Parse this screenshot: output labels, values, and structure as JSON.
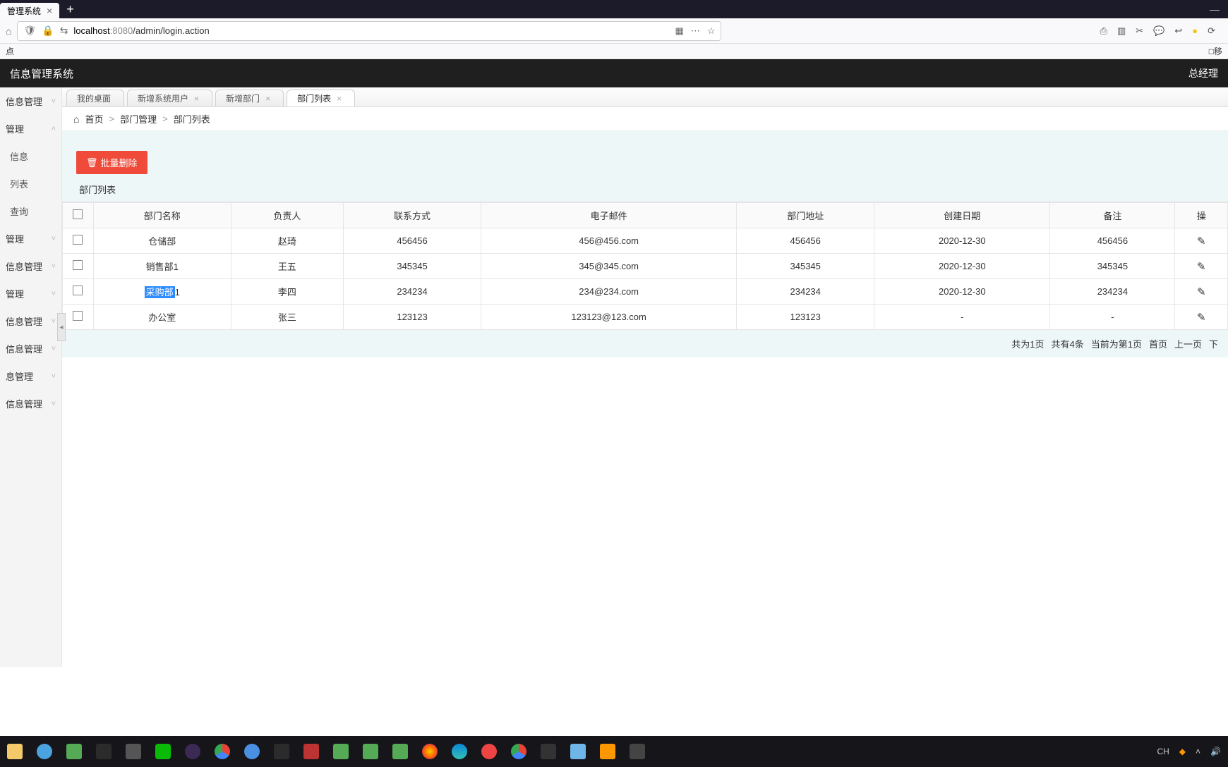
{
  "browser": {
    "tab_title": "管理系统",
    "url_host": "localhost",
    "url_port": ":8080",
    "url_path": "/admin/login.action",
    "bookmark": "点",
    "bookmark_right": "□移"
  },
  "header": {
    "title": "信息管理系统",
    "user": "总经理"
  },
  "sidebar": {
    "items": [
      {
        "label": "信息管理"
      },
      {
        "label": "管理"
      },
      {
        "label": "信息"
      },
      {
        "label": "列表"
      },
      {
        "label": "查询"
      },
      {
        "label": "管理"
      },
      {
        "label": "信息管理"
      },
      {
        "label": "管理"
      },
      {
        "label": "信息管理"
      },
      {
        "label": "信息管理"
      },
      {
        "label": "息管理"
      },
      {
        "label": "信息管理"
      }
    ]
  },
  "tabs": [
    {
      "label": "我的桌面",
      "closable": false
    },
    {
      "label": "新增系统用户",
      "closable": true
    },
    {
      "label": "新增部门",
      "closable": true
    },
    {
      "label": "部门列表",
      "closable": true
    }
  ],
  "breadcrumb": {
    "home": "首页",
    "mid": "部门管理",
    "last": "部门列表"
  },
  "toolbar": {
    "batch_delete": "批量删除"
  },
  "panel_title": "部门列表",
  "table": {
    "headers": [
      "部门名称",
      "负责人",
      "联系方式",
      "电子邮件",
      "部门地址",
      "创建日期",
      "备注",
      "操"
    ],
    "rows": [
      {
        "name": "仓储部",
        "leader": "赵琦",
        "phone": "456456",
        "email": "456@456.com",
        "addr": "456456",
        "date": "2020-12-30",
        "note": "456456"
      },
      {
        "name": "销售部1",
        "leader": "王五",
        "phone": "345345",
        "email": "345@345.com",
        "addr": "345345",
        "date": "2020-12-30",
        "note": "345345"
      },
      {
        "name": "采购部1",
        "leader": "李四",
        "phone": "234234",
        "email": "234@234.com",
        "addr": "234234",
        "date": "2020-12-30",
        "note": "234234",
        "selected": true
      },
      {
        "name": "办公室",
        "leader": "张三",
        "phone": "123123",
        "email": "123123@123.com",
        "addr": "123123",
        "date": "-",
        "note": "-"
      }
    ]
  },
  "pager": {
    "total_pages": "共为1页",
    "total_rows": "共有4条",
    "current": "当前为第1页",
    "first": "首页",
    "prev": "上一页",
    "next": "下"
  },
  "taskbar": {
    "ime": "CH"
  }
}
